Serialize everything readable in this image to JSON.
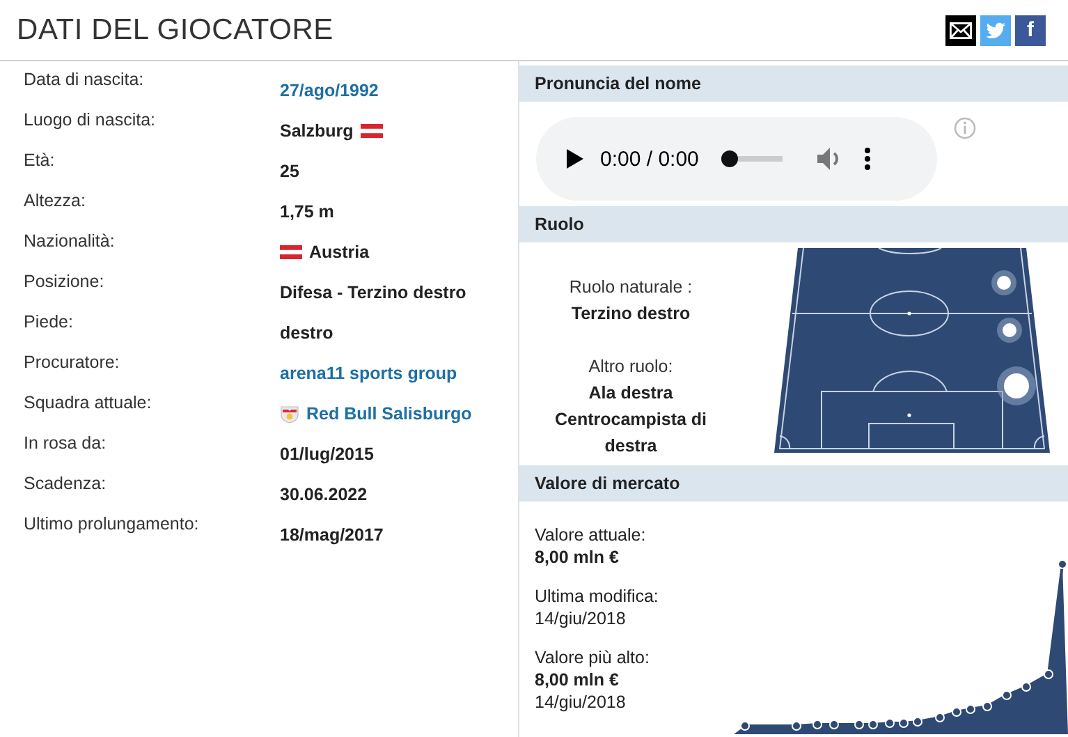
{
  "title": "DATI DEL GIOCATORE",
  "share": [
    {
      "kind": "mail"
    },
    {
      "kind": "twitter"
    },
    {
      "kind": "facebook",
      "label": "f"
    }
  ],
  "details": [
    {
      "label": "Data di nascita:",
      "value": "27/ago/1992",
      "kind": "link"
    },
    {
      "label": "Luogo di nascita:",
      "value": "Salzburg",
      "kind": "flagged"
    },
    {
      "label": "Età:",
      "value": "25",
      "kind": "text"
    },
    {
      "label": "Altezza:",
      "value": "1,75 m",
      "kind": "text"
    },
    {
      "label": "Nazionalità:",
      "value": "Austria",
      "kind": "nation"
    },
    {
      "label": "Posizione:",
      "value": "Difesa - Terzino destro",
      "kind": "text"
    },
    {
      "label": "Piede:",
      "value": "destro",
      "kind": "text"
    },
    {
      "label": "Procuratore:",
      "value": "arena11 sports group",
      "kind": "link"
    },
    {
      "label": "Squadra attuale:",
      "value": "Red Bull Salisburgo",
      "kind": "club"
    },
    {
      "label": "In rosa da:",
      "value": "01/lug/2015",
      "kind": "text"
    },
    {
      "label": "Scadenza:",
      "value": "30.06.2022",
      "kind": "text"
    },
    {
      "label": "Ultimo prolungamento:",
      "value": "18/mag/2017",
      "kind": "text"
    }
  ],
  "pronunciation": {
    "heading": "Pronuncia del nome",
    "time": "0:00 / 0:00",
    "level": 0
  },
  "role": {
    "heading": "Ruolo",
    "natural_label": "Ruolo naturale :",
    "natural": "Terzino destro",
    "other_label": "Altro ruolo:",
    "other": [
      "Ala destra",
      "Centrocampista di destra"
    ]
  },
  "market_value": {
    "heading": "Valore di mercato",
    "items": [
      {
        "label": "Valore attuale:",
        "value": "8,00 mln €"
      },
      {
        "label": "Ultima modifica:",
        "date": "14/giu/2018"
      },
      {
        "label": "Valore più alto:",
        "value": "8,00 mln €",
        "date": "14/giu/2018"
      }
    ]
  }
}
